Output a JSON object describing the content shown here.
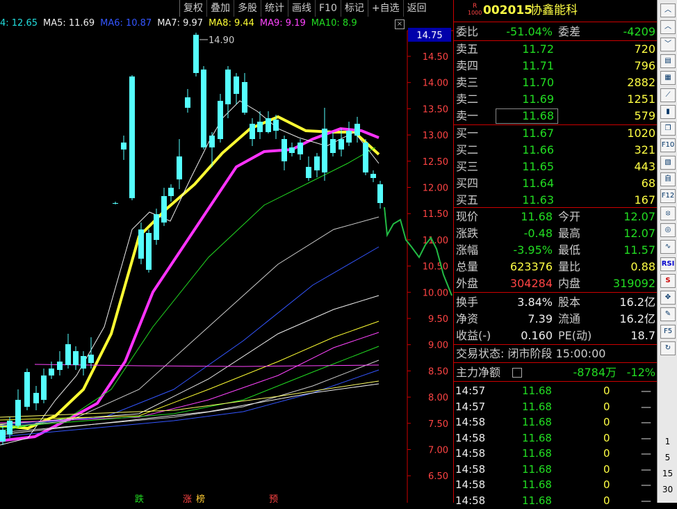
{
  "toolbar": [
    "复权",
    "叠加",
    "多股",
    "统计",
    "画线",
    "F10",
    "标记",
    "+自选",
    "返回"
  ],
  "ma_legend": [
    {
      "label": "4: 12.65",
      "color": "#22dddd"
    },
    {
      "label": "MA5: 11.69",
      "color": "#eeeeee"
    },
    {
      "label": "MA6: 10.87",
      "color": "#3355ff"
    },
    {
      "label": "MA7: 9.97",
      "color": "#eeeeee"
    },
    {
      "label": "MA8: 9.44",
      "color": "#ffff33"
    },
    {
      "label": "MA9: 9.19",
      "color": "#ff44ff"
    },
    {
      "label": "MA10: 8.9",
      "color": "#22dd22"
    }
  ],
  "price_axis": {
    "current": "14.75",
    "ticks": [
      "14.50",
      "14.00",
      "13.50",
      "13.00",
      "12.50",
      "12.00",
      "11.50",
      "11.00",
      "10.50",
      "10.00",
      "9.50",
      "9.00",
      "8.50",
      "8.00",
      "7.50",
      "7.00",
      "6.50"
    ]
  },
  "high_label": "14.90",
  "bottom_labels": [
    "跌",
    "涨",
    "榜",
    "预"
  ],
  "stock": {
    "code": "002015",
    "name": "协鑫能科",
    "badge_top": "R",
    "badge_bottom": "1000"
  },
  "summary": {
    "wb_label": "委比",
    "wb_value": "-51.04%",
    "wc_label": "委差",
    "wc_value": "-4209"
  },
  "sell": [
    {
      "label": "卖五",
      "price": "11.72",
      "qty": "720"
    },
    {
      "label": "卖四",
      "price": "11.71",
      "qty": "796"
    },
    {
      "label": "卖三",
      "price": "11.70",
      "qty": "2882"
    },
    {
      "label": "卖二",
      "price": "11.69",
      "qty": "1251"
    },
    {
      "label": "卖一",
      "price": "11.68",
      "qty": "579"
    }
  ],
  "buy": [
    {
      "label": "买一",
      "price": "11.67",
      "qty": "1020"
    },
    {
      "label": "买二",
      "price": "11.66",
      "qty": "321"
    },
    {
      "label": "买三",
      "price": "11.65",
      "qty": "443"
    },
    {
      "label": "买四",
      "price": "11.64",
      "qty": "68"
    },
    {
      "label": "买五",
      "price": "11.63",
      "qty": "167"
    }
  ],
  "stats": [
    {
      "l1": "现价",
      "v1": "11.68",
      "c1": "g",
      "l2": "今开",
      "v2": "12.07",
      "c2": "g"
    },
    {
      "l1": "涨跌",
      "v1": "-0.48",
      "c1": "g",
      "l2": "最高",
      "v2": "12.07",
      "c2": "g"
    },
    {
      "l1": "涨幅",
      "v1": "-3.95%",
      "c1": "g",
      "l2": "最低",
      "v2": "11.57",
      "c2": "g"
    },
    {
      "l1": "总量",
      "v1": "623376",
      "c1": "y",
      "l2": "量比",
      "v2": "0.88",
      "c2": "y"
    },
    {
      "l1": "外盘",
      "v1": "304284",
      "c1": "r",
      "l2": "内盘",
      "v2": "319092",
      "c2": "g"
    }
  ],
  "stats2": [
    {
      "l1": "换手",
      "v1": "3.84%",
      "l2": "股本",
      "v2": "16.2亿"
    },
    {
      "l1": "净资",
      "v1": "7.39",
      "l2": "流通",
      "v2": "16.2亿"
    },
    {
      "l1": "收益(-)",
      "v1": "0.160",
      "l2": "PE(动)",
      "v2": "18.7"
    }
  ],
  "trade_status": "交易状态: 闭市阶段 15:00:00",
  "main_flow": {
    "label": "主力净额",
    "value": "-8784万",
    "pct": "-12%"
  },
  "ticks": [
    {
      "time": "14:57",
      "price": "11.68",
      "vol": "0",
      "dir": "—"
    },
    {
      "time": "14:57",
      "price": "11.68",
      "vol": "0",
      "dir": "—"
    },
    {
      "time": "14:58",
      "price": "11.68",
      "vol": "0",
      "dir": "—"
    },
    {
      "time": "14:58",
      "price": "11.68",
      "vol": "0",
      "dir": "—"
    },
    {
      "time": "14:58",
      "price": "11.68",
      "vol": "0",
      "dir": "—"
    },
    {
      "time": "14:58",
      "price": "11.68",
      "vol": "0",
      "dir": "—"
    },
    {
      "time": "14:58",
      "price": "11.68",
      "vol": "0",
      "dir": "—"
    },
    {
      "time": "14:58",
      "price": "11.68",
      "vol": "0",
      "dir": "—"
    }
  ],
  "sidebar_icons": [
    "chevron-up-icon",
    "chevron-up-icon",
    "chevron-down-icon",
    "document-icon",
    "table-icon",
    "line-chart-icon",
    "candle-chart-icon",
    "window-icon",
    "f10-icon",
    "report-icon",
    "self-select-icon",
    "f12-icon",
    "indicator-icon",
    "settings-icon",
    "wave-icon",
    "rsi-icon",
    "s-icon",
    "move-icon",
    "pencil-icon",
    "f5-icon",
    "refresh-icon"
  ],
  "sidebar_labels": {
    "rsi": "RSI",
    "f5": "F5",
    "f10": "F10",
    "f12": "F12",
    "periods": [
      "1",
      "5",
      "15",
      "30"
    ]
  }
}
